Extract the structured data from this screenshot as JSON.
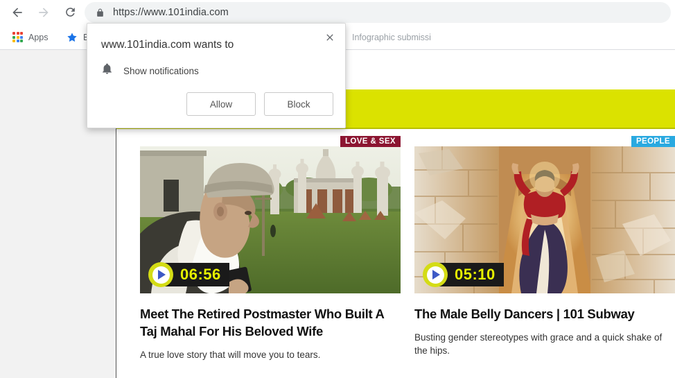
{
  "browser": {
    "nav": {
      "back_icon": "back-arrow-icon",
      "forward_icon": "forward-arrow-icon",
      "reload_icon": "reload-icon"
    },
    "omnibox": {
      "lock_icon": "lock-icon",
      "url": "https://www.101india.com"
    },
    "bookmarks": [
      {
        "label": "Apps",
        "icon": "apps-grid-icon"
      },
      {
        "label": "B",
        "icon": "star-icon"
      },
      {
        "label": "Infographic submissi",
        "icon": ""
      }
    ]
  },
  "permission_dialog": {
    "title": "www.101india.com wants to",
    "permission_icon": "bell-icon",
    "permission_label": "Show notifications",
    "allow_label": "Allow",
    "block_label": "Block",
    "close_icon": "close-icon"
  },
  "page": {
    "band_color": "#dbe200",
    "cards": [
      {
        "category": "LOVE & SEX",
        "category_color": "#8c1531",
        "duration": "06:56",
        "play_icon": "play-icon",
        "title": "Meet The Retired Postmaster Who Built A Taj Mahal For His Beloved Wife",
        "description": "A true love story that will move you to tears."
      },
      {
        "category": "PEOPLE",
        "category_color": "#29a9e0",
        "duration": "05:10",
        "play_icon": "play-icon",
        "title": "The Male Belly Dancers | 101 Subway",
        "description": "Busting gender stereotypes with grace and a quick shake of the hips."
      }
    ]
  }
}
